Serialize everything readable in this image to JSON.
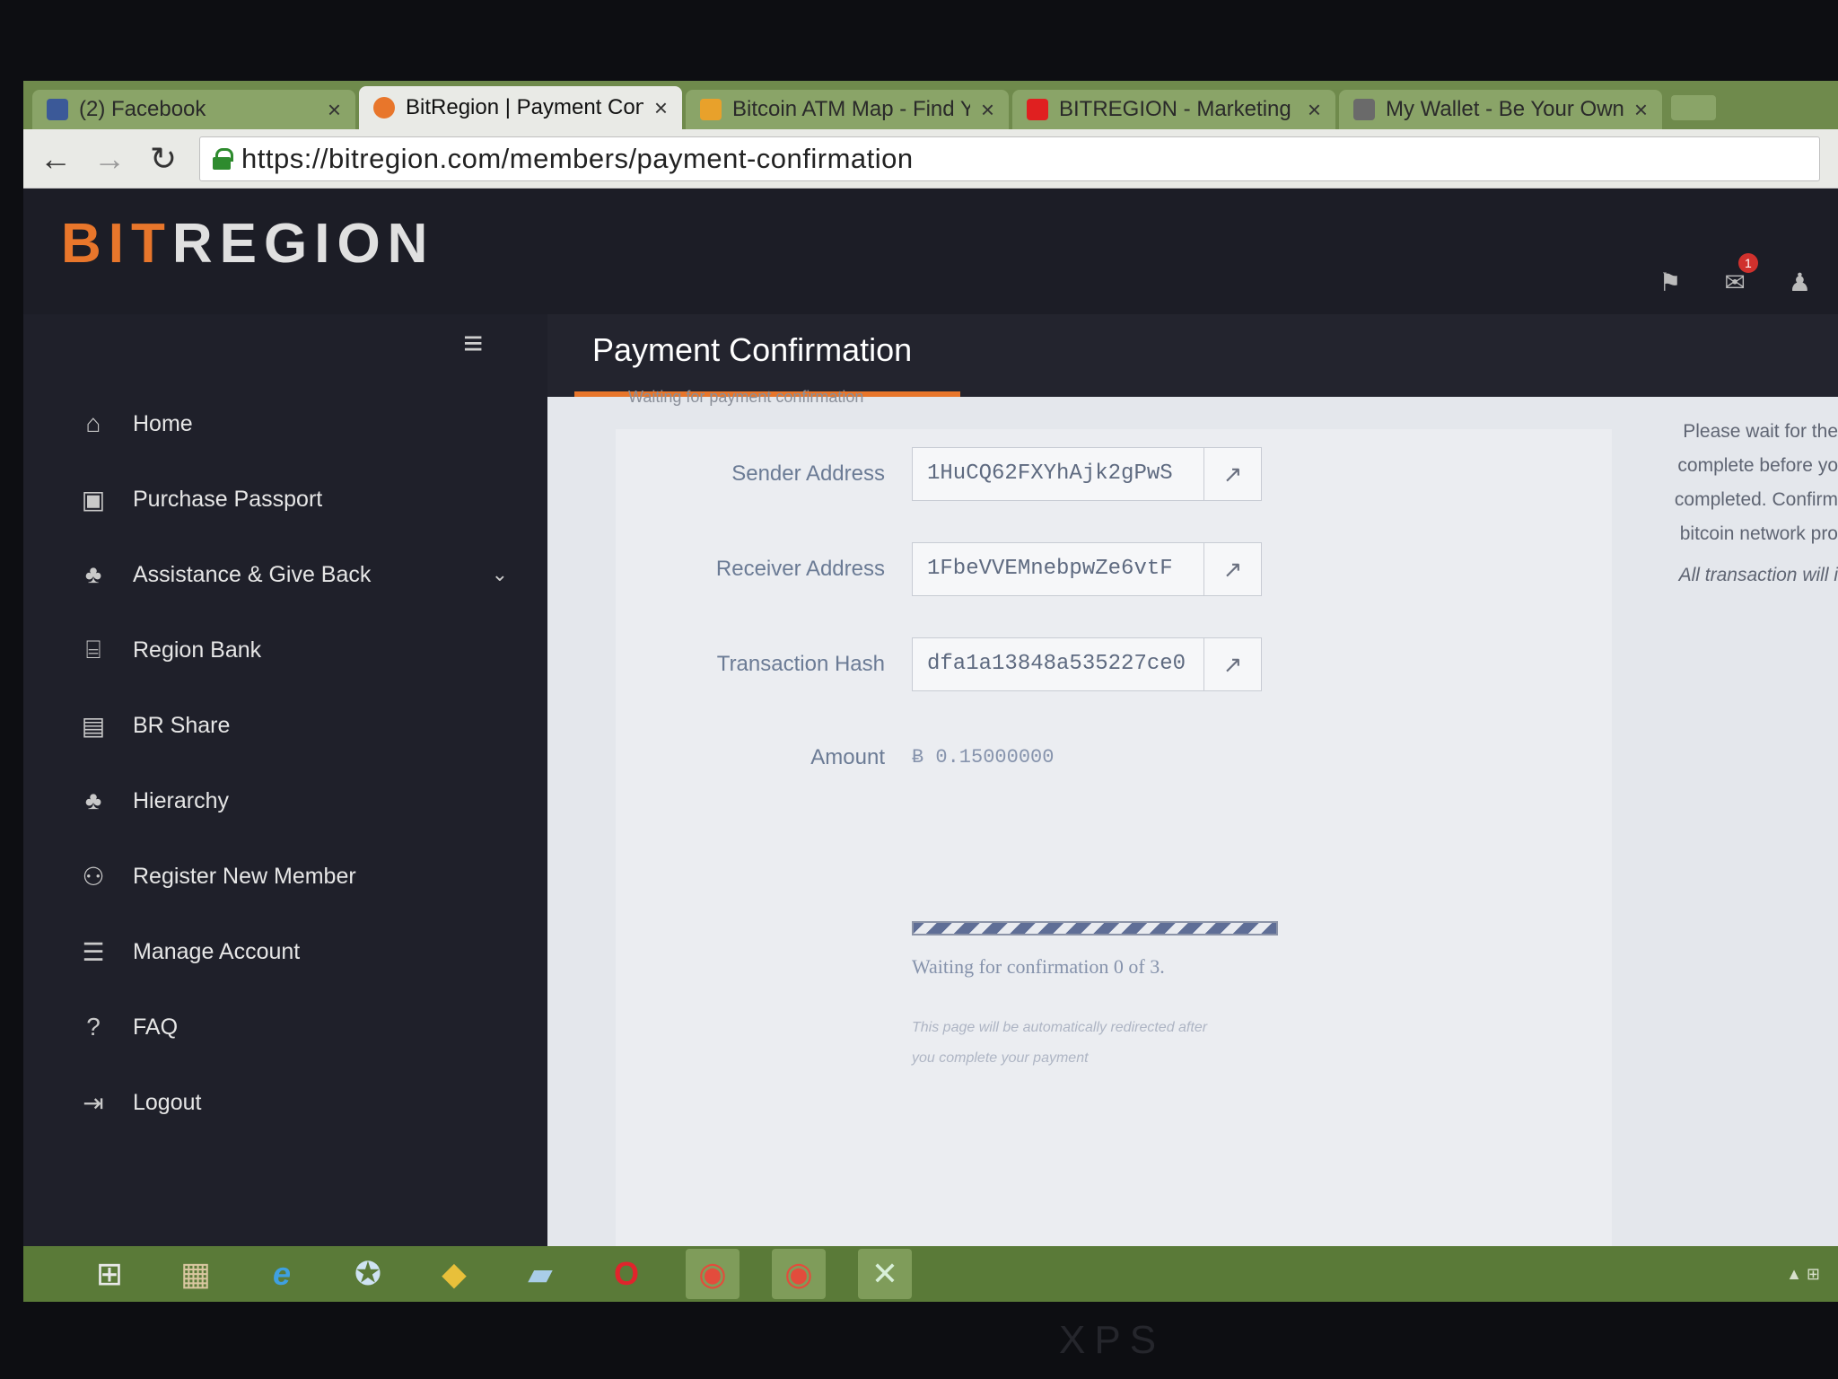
{
  "browser": {
    "tabs": [
      {
        "title": "(2) Facebook",
        "favicon_color": "#3b5998",
        "active": false
      },
      {
        "title": "BitRegion | Payment Confi",
        "favicon_color": "#e8762b",
        "active": true
      },
      {
        "title": "Bitcoin ATM Map - Find Yo",
        "favicon_color": "#e8a12b",
        "active": false
      },
      {
        "title": "BITREGION - Marketing Pl",
        "favicon_color": "#e02020",
        "active": false
      },
      {
        "title": "My Wallet - Be Your Own",
        "favicon_color": "#6a6a6a",
        "active": false
      }
    ],
    "close_glyph": "×",
    "url": "https://bitregion.com/members/payment-confirmation"
  },
  "header": {
    "logo_part1": "BIT",
    "logo_part2": "REGION",
    "notification_count": "1",
    "icons": [
      "flag-icon",
      "mail-icon",
      "user-icon"
    ]
  },
  "sidebar": {
    "items": [
      {
        "label": "Home",
        "icon": "home-icon",
        "glyph": "⌂"
      },
      {
        "label": "Purchase Passport",
        "icon": "passport-icon",
        "glyph": "▣"
      },
      {
        "label": "Assistance & Give Back",
        "icon": "sitemap-icon",
        "glyph": "♣",
        "has_submenu": true
      },
      {
        "label": "Region Bank",
        "icon": "bank-icon",
        "glyph": "⌸"
      },
      {
        "label": "BR Share",
        "icon": "briefcase-icon",
        "glyph": "▤"
      },
      {
        "label": "Hierarchy",
        "icon": "hierarchy-icon",
        "glyph": "♣"
      },
      {
        "label": "Register New Member",
        "icon": "add-user-icon",
        "glyph": "⚇"
      },
      {
        "label": "Manage Account",
        "icon": "list-icon",
        "glyph": "☰"
      },
      {
        "label": "FAQ",
        "icon": "question-icon",
        "glyph": "?"
      },
      {
        "label": "Logout",
        "icon": "logout-icon",
        "glyph": "⇥"
      }
    ],
    "submenu_glyph": "⌄",
    "menu_toggle_glyph": "≡"
  },
  "main": {
    "title": "Payment Confirmation",
    "tab_label": "Waiting for payment confirmation",
    "fields": {
      "sender_label": "Sender Address",
      "sender_value": "1HuCQ62FXYhAjk2gPwS",
      "receiver_label": "Receiver Address",
      "receiver_value": "1FbeVVEMnebpwZe6vtF",
      "hash_label": "Transaction Hash",
      "hash_value": "dfa1a13848a535227ce0",
      "amount_label": "Amount",
      "amount_value": "Ƀ 0.15000000"
    },
    "external_link_glyph": "↗",
    "progress": {
      "fraction": 1.0,
      "text": "Waiting for confirmation 0 of 3."
    },
    "redirect_note": "This page will be automatically redirected after you complete your payment",
    "right_note": [
      "Please wait for the",
      "complete before yo",
      "completed. Confirm",
      "bitcoin network pro",
      "All transaction will i"
    ]
  },
  "taskbar": {
    "apps": [
      {
        "name": "windows-start-icon",
        "glyph": "⊞"
      },
      {
        "name": "file-explorer-icon",
        "glyph": "▦"
      },
      {
        "name": "internet-explorer-icon",
        "glyph": "e"
      },
      {
        "name": "skype-icon",
        "glyph": "✪"
      },
      {
        "name": "bluestacks-icon",
        "glyph": "◆"
      },
      {
        "name": "notes-icon",
        "glyph": "▰"
      },
      {
        "name": "opera-icon",
        "glyph": "O"
      },
      {
        "name": "chrome-icon",
        "glyph": "◉"
      },
      {
        "name": "chrome-icon-2",
        "glyph": "◉"
      },
      {
        "name": "excel-icon",
        "glyph": "✕"
      }
    ]
  },
  "device": {
    "brand": "XPS"
  },
  "colors": {
    "accent": "#e8762b",
    "sidebar_bg": "#1f202a",
    "panel_bg": "#e4e7ec",
    "label": "#6b7b95",
    "taskbar": "#5a7a38"
  }
}
